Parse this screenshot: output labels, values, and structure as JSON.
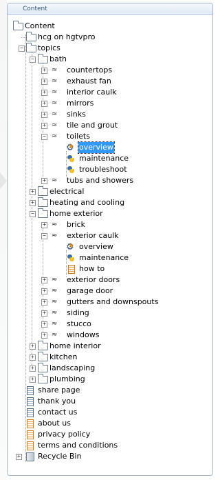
{
  "panel": {
    "title": "Content"
  },
  "tree": {
    "root": "Content",
    "hcg": "hcg on hgtvpro",
    "topics": "topics",
    "bath": "bath",
    "bath_items": [
      "countertops",
      "exhaust fan",
      "interior caulk",
      "mirrors",
      "sinks",
      "tile and grout"
    ],
    "toilets": "toilets",
    "toilets_children": [
      "overview",
      "maintenance",
      "troubleshoot"
    ],
    "tubs": "tubs and showers",
    "electrical": "electrical",
    "heating": "heating and cooling",
    "home_exterior": "home exterior",
    "brick": "brick",
    "exterior_caulk": "exterior caulk",
    "exterior_caulk_children": [
      "overview",
      "maintenance",
      "how to"
    ],
    "exterior_items": [
      "exterior doors",
      "garage door",
      "gutters and downspouts",
      "siding",
      "stucco",
      "windows"
    ],
    "after_topics": [
      "home interior",
      "kitchen",
      "landscaping",
      "plumbing"
    ],
    "pages": [
      "share page",
      "thank you",
      "contact us",
      "about us",
      "privacy policy",
      "terms and conditions"
    ],
    "recycle_bin": "Recycle Bin"
  },
  "state": {
    "selected_item": "overview"
  }
}
